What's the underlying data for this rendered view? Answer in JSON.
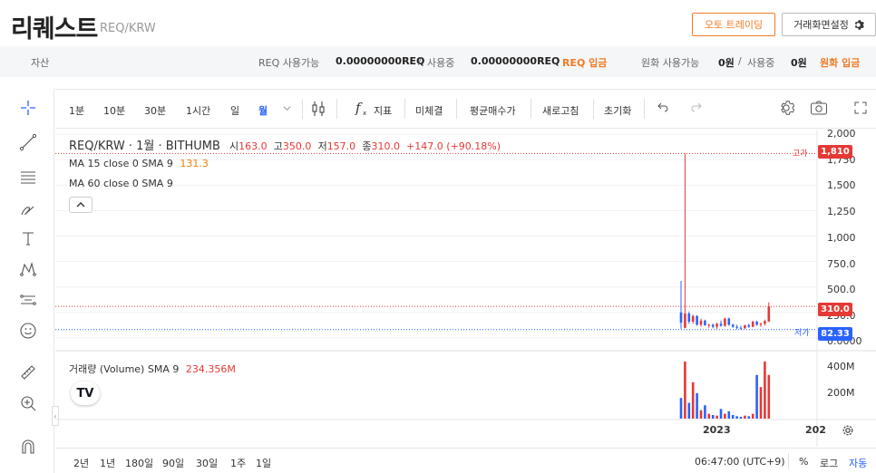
{
  "header": {
    "coin_name": "리퀘스트",
    "coin_pair": "REQ/KRW",
    "auto_trading_label": "오토 트레이딩",
    "screen_settings_label": "거래화면설정"
  },
  "balance": {
    "asset_label": "자산",
    "req_available_label": "REQ 사용가능",
    "req_available_value": "0.00000000REQ",
    "slash1": "/",
    "req_inuse_label": "사용중",
    "req_inuse_value": "0.00000000REQ",
    "req_deposit_label": "REQ 입금",
    "krw_available_label": "원화 사용가능",
    "krw_available_value": "0원",
    "slash2": "/",
    "krw_inuse_label": "사용중",
    "krw_inuse_value": "0원",
    "krw_deposit_label": "원화 입금"
  },
  "toolbar": {
    "intervals": [
      "1분",
      "10분",
      "30분",
      "1시간",
      "일",
      "월"
    ],
    "active_interval": "월",
    "indicators_label": "지표",
    "pending_label": "미체결",
    "avg_price_label": "평균매수가",
    "refresh_label": "새로고침",
    "reset_label": "초기화"
  },
  "legend": {
    "symbol": "REQ/KRW · 1월 · BITHUMB",
    "open_label": "시",
    "open_value": "163.0",
    "high_label": "고",
    "high_value": "350.0",
    "low_label": "저",
    "low_value": "157.0",
    "close_label": "종",
    "close_value": "310.0",
    "change": "+147.0 (+90.18%)",
    "ma15_label": "MA 15 close 0 SMA 9",
    "ma15_value": "131.3",
    "ma60_label": "MA 60 close 0 SMA 9",
    "volume_label": "거래량 (Volume) SMA 9",
    "volume_value": "234.356M"
  },
  "price_axis": {
    "ticks": [
      "2,000",
      "1,750",
      "1,500",
      "1,250",
      "1,000",
      "750.0",
      "500.0",
      "250.0",
      "0.0000"
    ],
    "high_tag": "고가",
    "high_badge": "1,810",
    "close_badge": "310.0",
    "low_tag": "저가",
    "low_badge": "82.33",
    "volume_ticks": [
      "400M",
      "200M"
    ]
  },
  "time_axis": {
    "labels": [
      "2023",
      "202"
    ]
  },
  "bottom": {
    "ranges": [
      "2년",
      "1년",
      "180일",
      "90일",
      "30일",
      "1주",
      "1일"
    ],
    "time": "06:47:00 (UTC+9)",
    "percent_label": "%",
    "log_label": "로그",
    "auto_label": "자동"
  },
  "colors": {
    "up": "#e53935",
    "down": "#2962ff",
    "accent": "#f07b25",
    "active": "#2962ff"
  },
  "chart_data": {
    "type": "candlestick",
    "ylim": [
      0,
      2000
    ],
    "candles": [
      {
        "o": 250,
        "h": 560,
        "l": 90,
        "c": 150
      },
      {
        "o": 100,
        "h": 1810,
        "l": 95,
        "c": 240
      },
      {
        "o": 240,
        "h": 260,
        "l": 140,
        "c": 160
      },
      {
        "o": 160,
        "h": 230,
        "l": 140,
        "c": 215
      },
      {
        "o": 215,
        "h": 225,
        "l": 120,
        "c": 130
      },
      {
        "o": 130,
        "h": 190,
        "l": 110,
        "c": 170
      },
      {
        "o": 170,
        "h": 180,
        "l": 120,
        "c": 125
      },
      {
        "o": 125,
        "h": 140,
        "l": 100,
        "c": 130
      },
      {
        "o": 130,
        "h": 140,
        "l": 95,
        "c": 110
      },
      {
        "o": 110,
        "h": 150,
        "l": 90,
        "c": 140
      },
      {
        "o": 140,
        "h": 170,
        "l": 110,
        "c": 120
      },
      {
        "o": 120,
        "h": 200,
        "l": 110,
        "c": 190
      },
      {
        "o": 190,
        "h": 200,
        "l": 120,
        "c": 130
      },
      {
        "o": 130,
        "h": 140,
        "l": 100,
        "c": 110
      },
      {
        "o": 110,
        "h": 130,
        "l": 85,
        "c": 100
      },
      {
        "o": 100,
        "h": 120,
        "l": 82,
        "c": 95
      },
      {
        "o": 95,
        "h": 130,
        "l": 90,
        "c": 125
      },
      {
        "o": 125,
        "h": 140,
        "l": 100,
        "c": 110
      },
      {
        "o": 110,
        "h": 170,
        "l": 105,
        "c": 160
      },
      {
        "o": 160,
        "h": 170,
        "l": 120,
        "c": 130
      },
      {
        "o": 130,
        "h": 150,
        "l": 110,
        "c": 140
      },
      {
        "o": 140,
        "h": 180,
        "l": 120,
        "c": 165
      },
      {
        "o": 163,
        "h": 350,
        "l": 157,
        "c": 310
      }
    ],
    "volume_max": 500,
    "volumes": [
      170,
      470,
      130,
      300,
      210,
      70,
      110,
      40,
      30,
      25,
      80,
      40,
      60,
      30,
      20,
      15,
      25,
      20,
      40,
      360,
      260,
      470,
      360
    ]
  }
}
